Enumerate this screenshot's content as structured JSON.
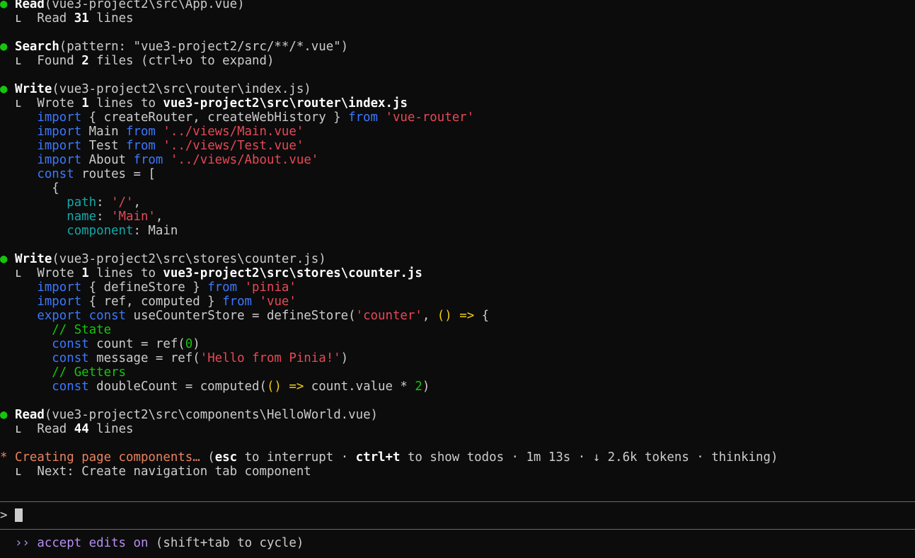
{
  "blocks": [
    {
      "kind": "tool",
      "tool": "Read",
      "args": "(vue3-project2\\src\\App.vue)",
      "result_pre": "Read ",
      "result_bold": "31",
      "result_post": " lines"
    },
    {
      "kind": "tool",
      "tool": "Search",
      "args": "(pattern: \"vue3-project2/src/**/*.vue\")",
      "result_pre": "Found ",
      "result_bold": "2",
      "result_post": " files (ctrl+o to expand)"
    },
    {
      "kind": "write",
      "tool": "Write",
      "args": "(vue3-project2\\src\\router\\index.js)",
      "wrote_pre": "Wrote ",
      "wrote_count": "1",
      "wrote_mid": " lines to ",
      "wrote_path": "vue3-project2\\src\\router\\index.js"
    },
    {
      "kind": "write",
      "tool": "Write",
      "args": "(vue3-project2\\src\\stores\\counter.js)",
      "wrote_pre": "Wrote ",
      "wrote_count": "1",
      "wrote_mid": " lines to ",
      "wrote_path": "vue3-project2\\src\\stores\\counter.js"
    },
    {
      "kind": "tool",
      "tool": "Read",
      "args": "(vue3-project2\\src\\components\\HelloWorld.vue)",
      "result_pre": "Read ",
      "result_bold": "44",
      "result_post": " lines"
    }
  ],
  "router_code": {
    "import": "import",
    "from": "from",
    "const": "const",
    "l1_mid": " { createRouter, createWebHistory } ",
    "l1_str": "'vue-router'",
    "l2_mid": " Main ",
    "l2_str": "'../views/Main.vue'",
    "l3_mid": " Test ",
    "l3_str": "'../views/Test.vue'",
    "l4_mid": " About ",
    "l4_str": "'../views/About.vue'",
    "l5_rest": " routes = [",
    "l6": "{",
    "path_key": "path",
    "path_val": "'/'",
    "name_key": "name",
    "name_val": "'Main'",
    "comp_key": "component",
    "comp_val": " Main"
  },
  "store_code": {
    "import": "import",
    "from": "from",
    "export": "export",
    "const": "const",
    "l1_mid": " { defineStore } ",
    "l1_str": "'pinia'",
    "l2_mid": " { ref, computed } ",
    "l2_str": "'vue'",
    "l3_mid": " useCounterStore = defineStore(",
    "l3_str": "'counter'",
    "l3_comma": ", ",
    "l3_parens": "()",
    "l3_arrow": " => ",
    "l3_brace": "{",
    "c_state": "// State",
    "l5_mid": " count = ref(",
    "l5_num": "0",
    "l5_end": ")",
    "l6_mid": " message = ref(",
    "l6_str": "'Hello from Pinia!'",
    "l6_end": ")",
    "c_getters": "// Getters",
    "l8_mid": " doubleCount = computed(",
    "l8_parens": "()",
    "l8_arrow": " =>",
    "l8_rest": " count.value * ",
    "l8_num": "2",
    "l8_end": ")"
  },
  "glyphs": {
    "bullet": "●",
    "elbow": "ʟ",
    "spinner": "*"
  },
  "activity": {
    "title": "Creating page components…",
    "paren_open": " (",
    "esc": "esc",
    "esc_text": " to interrupt · ",
    "ctrl": "ctrl+t",
    "ctrl_text": " to show todos · 1m 13s · ↓ 2.6k tokens · thinking)",
    "next": "Next: Create navigation tab component"
  },
  "prompt": {
    "symbol": ">"
  },
  "status": {
    "chevrons": "››",
    "mode": "accept edits on",
    "hint": " (shift+tab to cycle)"
  },
  "colors": {
    "background": "#0c0c0c",
    "bullet_green": "#16c60c",
    "keyword_blue": "#3b78ff",
    "string_red": "#e74856",
    "property_teal": "#13a8a8",
    "activity_orange": "#e8825f",
    "mode_purple": "#b48ef0"
  }
}
